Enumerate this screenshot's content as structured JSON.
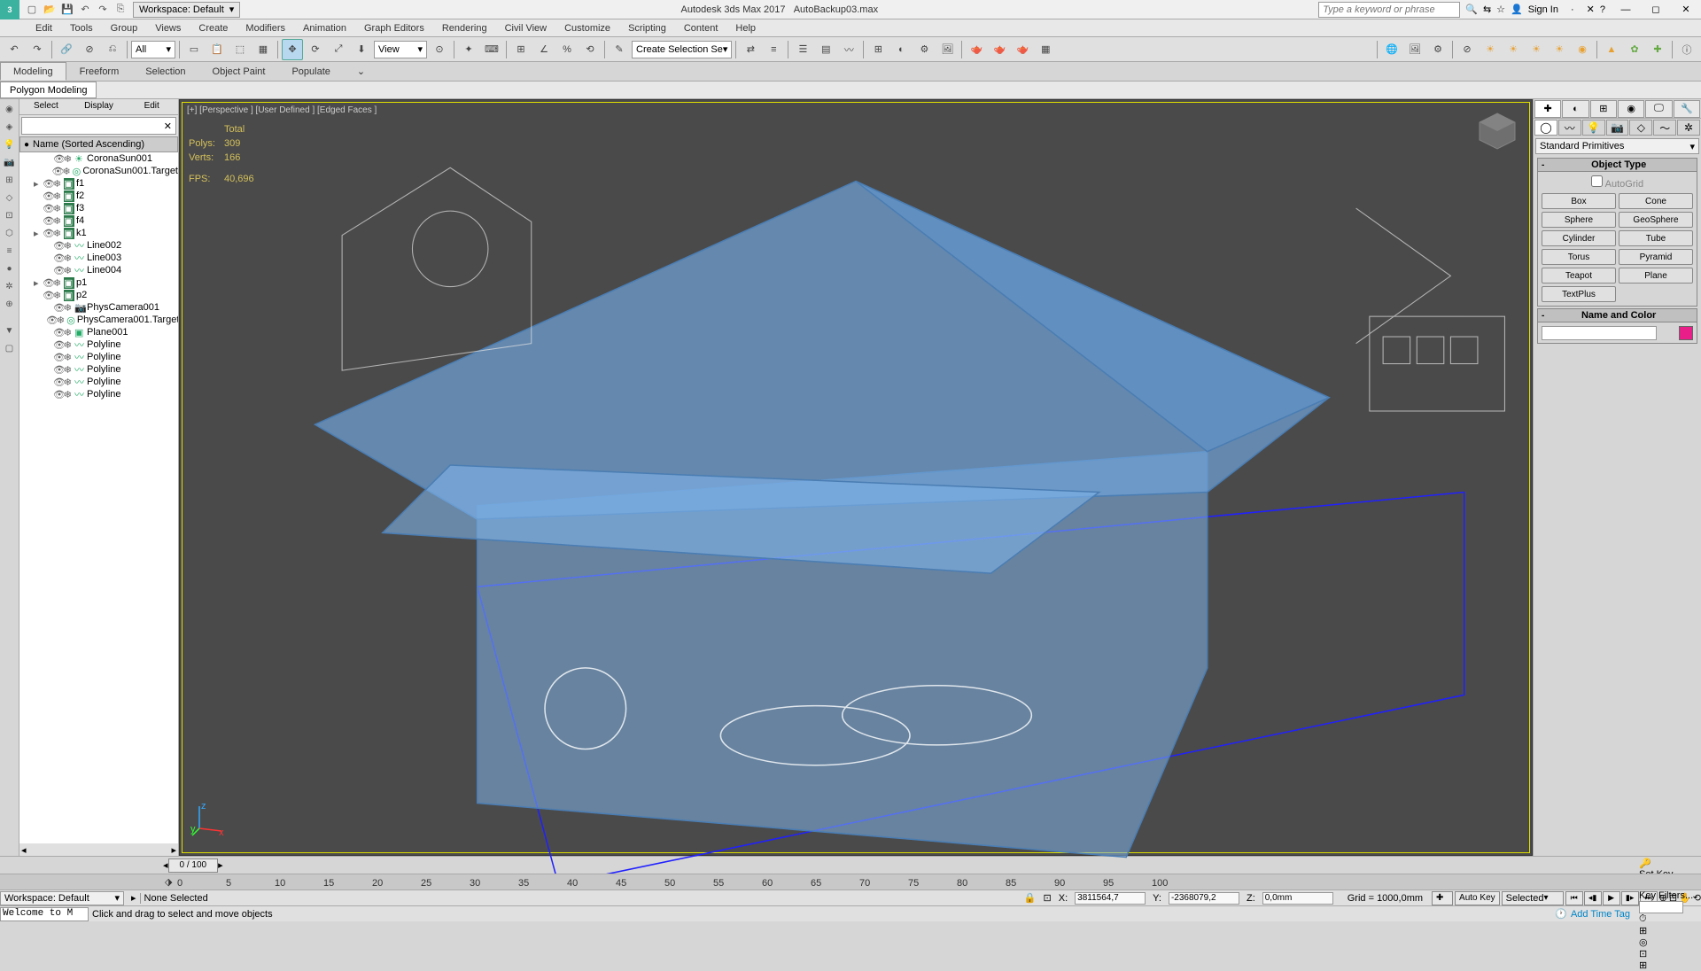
{
  "titlebar": {
    "workspace": "Workspace: Default",
    "app": "Autodesk 3ds Max 2017",
    "file": "AutoBackup03.max",
    "search_ph": "Type a keyword or phrase",
    "signin": "Sign In"
  },
  "menu": [
    "Edit",
    "Tools",
    "Group",
    "Views",
    "Create",
    "Modifiers",
    "Animation",
    "Graph Editors",
    "Rendering",
    "Civil View",
    "Customize",
    "Scripting",
    "Content",
    "Help"
  ],
  "toolbar": {
    "filter": "All",
    "view": "View",
    "createsel": "Create Selection Se"
  },
  "ribbon": {
    "tabs": [
      "Modeling",
      "Freeform",
      "Selection",
      "Object Paint",
      "Populate"
    ],
    "sub": "Polygon Modeling"
  },
  "scene": {
    "tabs": [
      "Select",
      "Display",
      "Edit"
    ],
    "header": "Name (Sorted Ascending)",
    "nodes": [
      {
        "n": "CoronaSun001",
        "i": "sun",
        "d": 2
      },
      {
        "n": "CoronaSun001.Target",
        "i": "tgt",
        "d": 2
      },
      {
        "n": "f1",
        "i": "box",
        "d": 1,
        "exp": true,
        "hi": true
      },
      {
        "n": "f2",
        "i": "box",
        "d": 1,
        "hi": true
      },
      {
        "n": "f3",
        "i": "box",
        "d": 1,
        "hi": true
      },
      {
        "n": "f4",
        "i": "box",
        "d": 1,
        "hi": true
      },
      {
        "n": "k1",
        "i": "box",
        "d": 1,
        "exp": true,
        "hi": true
      },
      {
        "n": "Line002",
        "i": "line",
        "d": 2
      },
      {
        "n": "Line003",
        "i": "line",
        "d": 2
      },
      {
        "n": "Line004",
        "i": "line",
        "d": 2
      },
      {
        "n": "p1",
        "i": "box",
        "d": 1,
        "exp": true,
        "hi": true
      },
      {
        "n": "p2",
        "i": "box",
        "d": 1,
        "hi": true
      },
      {
        "n": "PhysCamera001",
        "i": "cam",
        "d": 2
      },
      {
        "n": "PhysCamera001.Target",
        "i": "tgt",
        "d": 2
      },
      {
        "n": "Plane001",
        "i": "box",
        "d": 2
      },
      {
        "n": "Polyline",
        "i": "line",
        "d": 2
      },
      {
        "n": "Polyline",
        "i": "line",
        "d": 2
      },
      {
        "n": "Polyline",
        "i": "line",
        "d": 2
      },
      {
        "n": "Polyline",
        "i": "line",
        "d": 2
      },
      {
        "n": "Polyline",
        "i": "line",
        "d": 2
      }
    ]
  },
  "viewport": {
    "label": "[+] [Perspective ] [User Defined ] [Edged Faces ]",
    "stats": {
      "total_lbl": "Total",
      "polys_lbl": "Polys:",
      "polys": "309",
      "verts_lbl": "Verts:",
      "verts": "166",
      "fps_lbl": "FPS:",
      "fps": "40,696"
    }
  },
  "cmd": {
    "dd": "Standard Primitives",
    "obj_type": "Object Type",
    "autogrid": "AutoGrid",
    "prims": [
      "Box",
      "Cone",
      "Sphere",
      "GeoSphere",
      "Cylinder",
      "Tube",
      "Torus",
      "Pyramid",
      "Teapot",
      "Plane",
      "TextPlus",
      ""
    ],
    "name_color": "Name and Color"
  },
  "time": {
    "slider": "0 / 100",
    "ticks": [
      0,
      5,
      10,
      15,
      20,
      25,
      30,
      35,
      40,
      45,
      50,
      55,
      60,
      65,
      70,
      75,
      80,
      85,
      90,
      95,
      100
    ]
  },
  "status": {
    "ws": "Workspace: Default",
    "sel": "None Selected",
    "hint": "Click and drag to select and move objects",
    "msg": "Welcome to M",
    "x_lbl": "X:",
    "x": "3811564,7",
    "y_lbl": "Y:",
    "y": "-2368079,2",
    "z_lbl": "Z:",
    "z": "0,0mm",
    "grid": "Grid = 1000,0mm",
    "autokey": "Auto Key",
    "selected": "Selected",
    "setkey": "Set Key",
    "keyfilters": "Key Filters...",
    "addtag": "Add Time Tag"
  }
}
